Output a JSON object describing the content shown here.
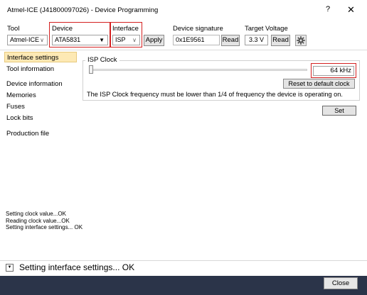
{
  "window": {
    "title": "Atmel-ICE (J41800097026) - Device Programming",
    "help_label": "?",
    "close_label": "✕"
  },
  "toolbar": {
    "tool_label": "Tool",
    "tool_value": "Atmel-ICE",
    "device_label": "Device",
    "device_value": "ATA5831",
    "interface_label": "Interface",
    "interface_value": "ISP",
    "apply_label": "Apply",
    "signature_label": "Device signature",
    "signature_value": "0x1E9561",
    "signature_read_label": "Read",
    "voltage_label": "Target Voltage",
    "voltage_value": "3.3 V",
    "voltage_read_label": "Read",
    "settings_icon": "gear-icon"
  },
  "sidebar": {
    "items": [
      {
        "label": "Interface settings",
        "active": true
      },
      {
        "label": "Tool information",
        "active": false
      },
      {
        "label": "Device information",
        "active": false
      },
      {
        "label": "Memories",
        "active": false
      },
      {
        "label": "Fuses",
        "active": false
      },
      {
        "label": "Lock bits",
        "active": false
      },
      {
        "label": "Production file",
        "active": false
      }
    ]
  },
  "isp_clock": {
    "group_title": "ISP Clock",
    "frequency_value": "64 kHz",
    "slider_position": 0,
    "reset_label": "Reset to default clock",
    "note": "The ISP Clock frequency must be lower than 1/4 of frequency the device is operating on.",
    "set_label": "Set"
  },
  "log": {
    "lines": [
      "Setting clock value...OK",
      "Reading clock value...OK",
      "Setting interface settings... OK"
    ]
  },
  "status": {
    "text": "Setting interface settings... OK",
    "expander_icon": "expand-icon"
  },
  "footer": {
    "close_label": "Close"
  },
  "colors": {
    "highlight_box": "#d42020",
    "active_item_bg": "#fde9b4",
    "bottom_bar": "#2b3449"
  }
}
